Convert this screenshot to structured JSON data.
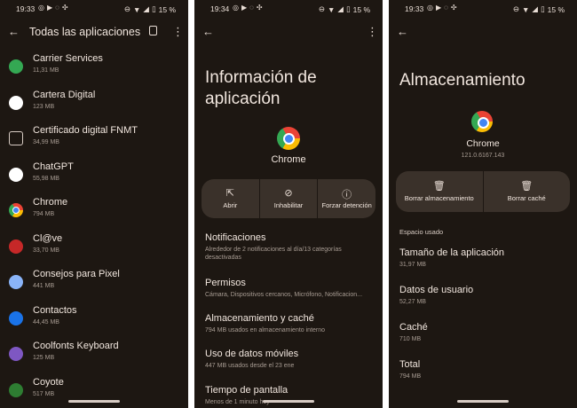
{
  "screen1": {
    "status_time": "19:33",
    "battery": "15 %",
    "title": "Todas las aplicaciones",
    "apps": [
      {
        "name": "Carrier Services",
        "size": "11,31 MB",
        "icon": "carrier-services-icon",
        "color": "#34a853"
      },
      {
        "name": "Cartera Digital",
        "size": "123 MB",
        "icon": "wallet-icon",
        "color": "#ffffff"
      },
      {
        "name": "Certificado digital FNMT",
        "size": "34,99 MB",
        "icon": "fnmt-icon",
        "color": "#1d1712"
      },
      {
        "name": "ChatGPT",
        "size": "55,98 MB",
        "icon": "chatgpt-icon",
        "color": "#ffffff"
      },
      {
        "name": "Chrome",
        "size": "794 MB",
        "icon": "chrome-icon",
        "color": "#4285f4"
      },
      {
        "name": "Cl@ve",
        "size": "33,70 MB",
        "icon": "clave-icon",
        "color": "#c62828"
      },
      {
        "name": "Consejos para Pixel",
        "size": "441 MB",
        "icon": "pixel-tips-icon",
        "color": "#8ab4f8"
      },
      {
        "name": "Contactos",
        "size": "44,45 MB",
        "icon": "contacts-icon",
        "color": "#1a73e8"
      },
      {
        "name": "Coolfonts Keyboard",
        "size": "125 MB",
        "icon": "coolfonts-icon",
        "color": "#7e57c2"
      },
      {
        "name": "Coyote",
        "size": "517 MB",
        "icon": "coyote-icon",
        "color": "#2e7d32"
      }
    ]
  },
  "screen2": {
    "status_time": "19:34",
    "battery": "15 %",
    "title": "Información de aplicación",
    "app_name": "Chrome",
    "actions": [
      {
        "label": "Abrir",
        "icon": "open-icon"
      },
      {
        "label": "Inhabilitar",
        "icon": "disable-icon"
      },
      {
        "label": "Forzar detención",
        "icon": "force-stop-icon"
      }
    ],
    "settings": [
      {
        "title": "Notificaciones",
        "subtitle": "Alrededor de 2 notificaciones al día/13 categorías desactivadas"
      },
      {
        "title": "Permisos",
        "subtitle": "Cámara, Dispositivos cercanos, Micrófono, Notificacion..."
      },
      {
        "title": "Almacenamiento y caché",
        "subtitle": "794 MB usados en almacenamiento interno"
      },
      {
        "title": "Uso de datos móviles",
        "subtitle": "447 MB usados desde el 23 ene"
      },
      {
        "title": "Tiempo de pantalla",
        "subtitle": "Menos de 1 minuto hoy"
      }
    ]
  },
  "screen3": {
    "status_time": "19:33",
    "battery": "15 %",
    "title": "Almacenamiento",
    "app_name": "Chrome",
    "version": "121.0.6167.143",
    "actions": [
      {
        "label": "Borrar almacenamiento",
        "icon": "trash-icon"
      },
      {
        "label": "Borrar caché",
        "icon": "trash-icon"
      }
    ],
    "section_label": "Espacio usado",
    "items": [
      {
        "title": "Tamaño de la aplicación",
        "value": "31,97 MB"
      },
      {
        "title": "Datos de usuario",
        "value": "52,27 MB"
      },
      {
        "title": "Caché",
        "value": "710 MB"
      },
      {
        "title": "Total",
        "value": "794 MB"
      }
    ]
  }
}
